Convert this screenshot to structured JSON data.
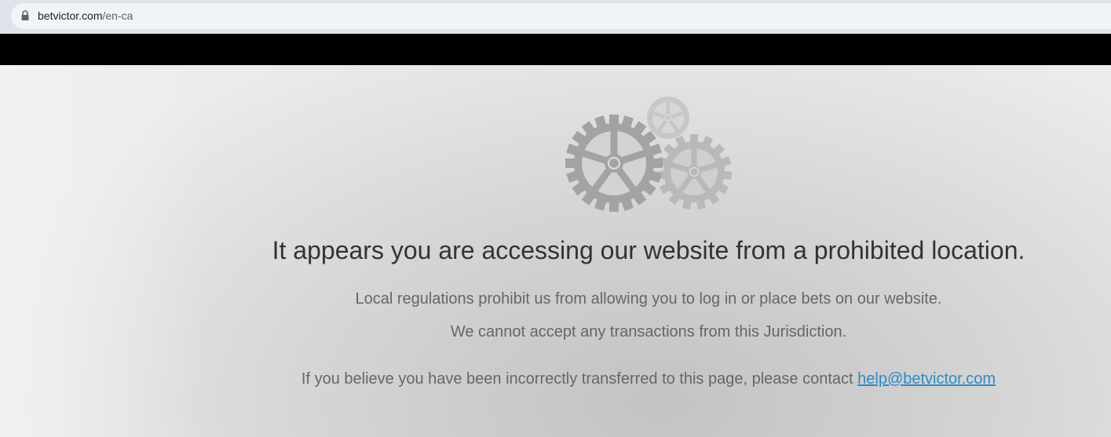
{
  "browser": {
    "url_domain": "betvictor.com",
    "url_path": "/en-ca"
  },
  "main": {
    "headline": "It appears you are accessing our website from a prohibited location.",
    "line1": "Local regulations prohibit us from allowing you to log in or place bets on our website.",
    "line2": "We cannot accept any transactions from this Jurisdiction.",
    "contact_text": "If you believe you have been incorrectly transferred to this page, please contact ",
    "contact_email": "help@betvictor.com"
  },
  "colors": {
    "headline": "#333333",
    "body_text": "#666666",
    "link": "#2d8ac8",
    "nav_bar": "#000000",
    "gear_dark": "#a3a3a3",
    "gear_light": "#b9b9b9"
  },
  "icons": {
    "lock": "lock-icon",
    "gears": "gears-icon"
  }
}
